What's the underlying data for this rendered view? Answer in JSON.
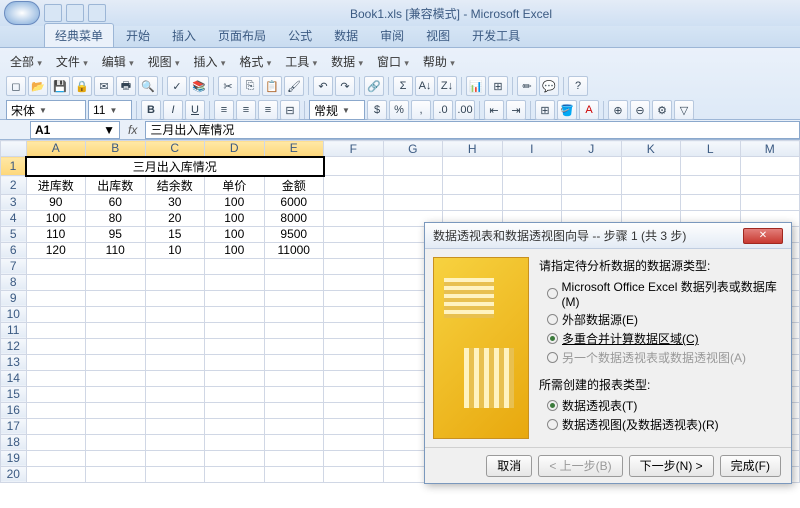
{
  "title": "Book1.xls  [兼容模式] - Microsoft Excel",
  "tabs": [
    "经典菜单",
    "开始",
    "插入",
    "页面布局",
    "公式",
    "数据",
    "审阅",
    "视图",
    "开发工具"
  ],
  "active_tab": 0,
  "menubar": [
    "全部",
    "文件",
    "编辑",
    "视图",
    "插入",
    "格式",
    "工具",
    "数据",
    "窗口",
    "帮助"
  ],
  "font_name": "宋体",
  "font_size": "11",
  "regular_label": "常规",
  "name_box": "A1",
  "formula": "三月出入库情况",
  "fx": "fx",
  "columns": [
    "A",
    "B",
    "C",
    "D",
    "E",
    "F",
    "G",
    "H",
    "I",
    "J",
    "K",
    "L",
    "M"
  ],
  "row_count": 20,
  "merged_title": "三月出入库情况",
  "headers": [
    "进库数",
    "出库数",
    "结余数",
    "单价",
    "金额"
  ],
  "rows": [
    [
      "90",
      "60",
      "30",
      "100",
      "6000"
    ],
    [
      "100",
      "80",
      "20",
      "100",
      "8000"
    ],
    [
      "110",
      "95",
      "15",
      "100",
      "9500"
    ],
    [
      "120",
      "110",
      "10",
      "100",
      "11000"
    ]
  ],
  "wizard": {
    "title": "数据透视表和数据透视图向导 -- 步骤 1 (共 3 步)",
    "section1": "请指定待分析数据的数据源类型:",
    "opt1": "Microsoft Office Excel 数据列表或数据库(M)",
    "opt2": "外部数据源(E)",
    "opt3": "多重合并计算数据区域(C)",
    "opt4": "另一个数据透视表或数据透视图(A)",
    "section2": "所需创建的报表类型:",
    "opt5": "数据透视表(T)",
    "opt6": "数据透视图(及数据透视表)(R)",
    "btn_cancel": "取消",
    "btn_back": "< 上一步(B)",
    "btn_next": "下一步(N) >",
    "btn_finish": "完成(F)"
  }
}
